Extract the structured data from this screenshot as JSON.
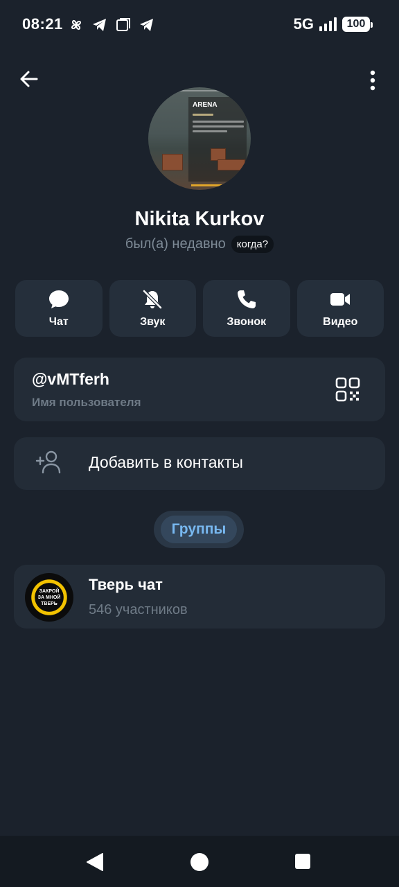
{
  "status_bar": {
    "time": "08:21",
    "network": "5G",
    "battery": "100",
    "notification_icons": [
      "pinwheel-icon",
      "telegram-icon",
      "square-icon",
      "telegram-icon"
    ]
  },
  "top_bar": {
    "back_icon": "arrow-left-icon",
    "menu_icon": "more-vertical-icon"
  },
  "profile": {
    "avatar_title": "ARENA",
    "name": "Nikita Kurkov",
    "last_seen": "был(а) недавно",
    "when_chip": "когда?"
  },
  "actions": [
    {
      "label": "Чат",
      "icon": "chat-bubble-icon"
    },
    {
      "label": "Звук",
      "icon": "bell-off-icon"
    },
    {
      "label": "Звонок",
      "icon": "phone-icon"
    },
    {
      "label": "Видео",
      "icon": "video-camera-icon"
    }
  ],
  "username": {
    "value": "@vMTferh",
    "caption": "Имя пользователя",
    "qr_icon": "qr-code-icon"
  },
  "add_contact": {
    "label": "Добавить в контакты",
    "icon": "add-person-icon"
  },
  "groups_section": {
    "label": "Группы"
  },
  "groups": [
    {
      "name": "Тверь чат",
      "members": "546 участников",
      "avatar_text": "ЗАКРОЙ ЗА МНОЙ ТВЕРЬ"
    }
  ],
  "nav_bar": {
    "back_icon": "triangle-back-icon",
    "home_icon": "circle-home-icon",
    "recents_icon": "square-recents-icon"
  },
  "colors": {
    "background": "#1b222c",
    "card": "#232c37",
    "accent": "#78b8f0",
    "muted_text": "#7d8a96"
  }
}
